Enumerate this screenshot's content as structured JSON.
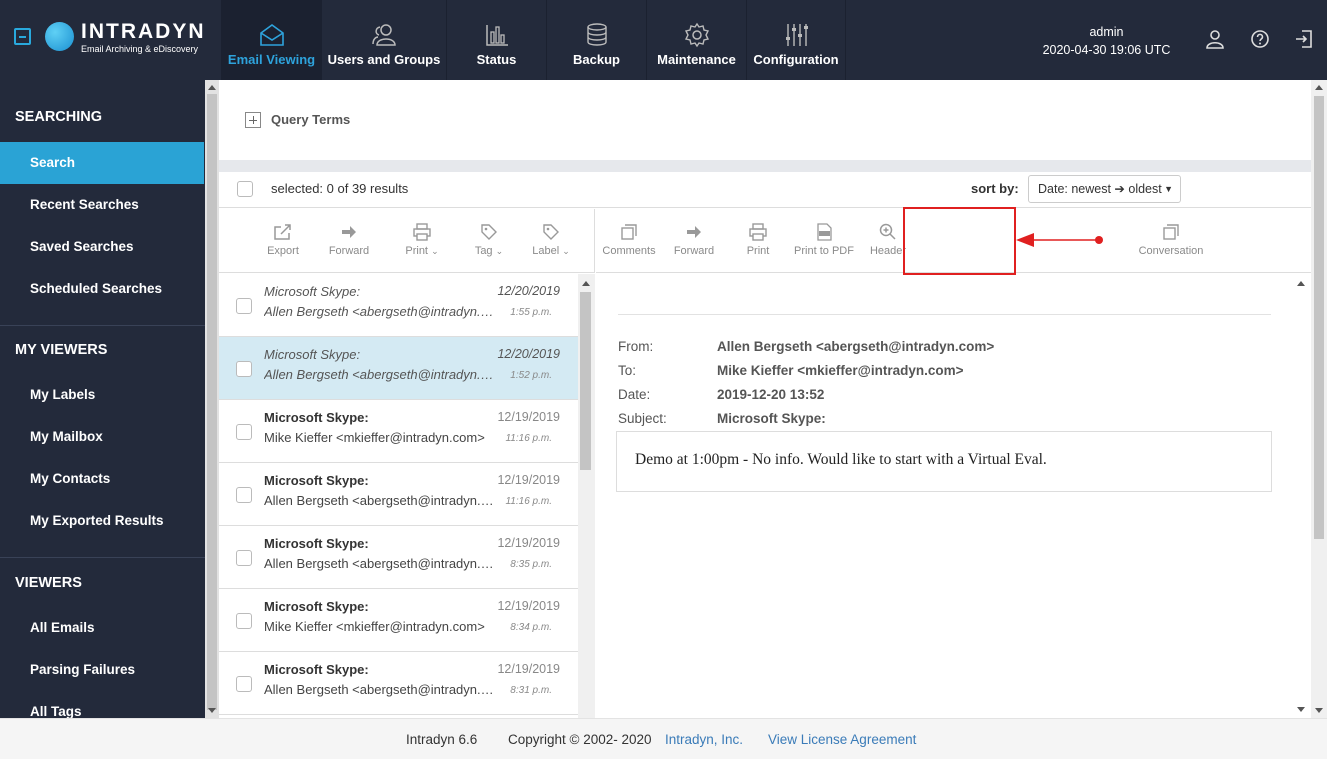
{
  "brand": {
    "name": "INTRADYN",
    "tagline": "Email Archiving & eDiscovery"
  },
  "nav": [
    {
      "label": "Email Viewing",
      "icon": "envelope-icon",
      "active": true
    },
    {
      "label": "Users and Groups",
      "icon": "users-icon"
    },
    {
      "label": "Status",
      "icon": "bar-chart-icon"
    },
    {
      "label": "Backup",
      "icon": "database-icon"
    },
    {
      "label": "Maintenance",
      "icon": "gear-icon"
    },
    {
      "label": "Configuration",
      "icon": "sliders-icon"
    }
  ],
  "user": {
    "name": "admin",
    "datetime": "2020-04-30 19:06 UTC"
  },
  "sidebar": {
    "sections": [
      {
        "title": "SEARCHING",
        "items": [
          "Search",
          "Recent Searches",
          "Saved Searches",
          "Scheduled Searches"
        ]
      },
      {
        "title": "MY VIEWERS",
        "items": [
          "My Labels",
          "My Mailbox",
          "My Contacts",
          "My Exported Results"
        ]
      },
      {
        "title": "VIEWERS",
        "items": [
          "All Emails",
          "Parsing Failures",
          "All Tags"
        ]
      }
    ],
    "active_item": "Search"
  },
  "query": {
    "label": "Query Terms"
  },
  "results": {
    "selected_text": "selected: 0 of 39 results",
    "sort_label": "sort by:",
    "sort_value": "Date: newest ➔ oldest"
  },
  "toolbar_left": [
    {
      "label": "Export",
      "icon": "export-icon"
    },
    {
      "label": "Forward",
      "icon": "forward-arrow-icon"
    },
    {
      "label": "Print",
      "icon": "printer-icon",
      "dropdown": true
    },
    {
      "label": "Tag",
      "icon": "tag-icon",
      "dropdown": true
    },
    {
      "label": "Label",
      "icon": "label-icon",
      "dropdown": true
    }
  ],
  "toolbar_right": [
    {
      "label": "Comments",
      "icon": "comments-icon"
    },
    {
      "label": "Forward",
      "icon": "forward-arrow-icon"
    },
    {
      "label": "Print",
      "icon": "printer-icon"
    },
    {
      "label": "Print to PDF",
      "icon": "pdf-icon"
    },
    {
      "label": "Header",
      "icon": "zoom-in-icon"
    },
    {
      "label": "Conversation",
      "icon": "conversation-icon"
    }
  ],
  "emails": [
    {
      "subject": "Microsoft Skype:",
      "from": "Allen Bergseth <abergseth@intradyn.com>",
      "date": "12/20/2019",
      "time": "1:55 p.m.",
      "read": true
    },
    {
      "subject": "Microsoft Skype:",
      "from": "Allen Bergseth <abergseth@intradyn.com>",
      "date": "12/20/2019",
      "time": "1:52 p.m.",
      "read": true,
      "selected": true
    },
    {
      "subject": "Microsoft Skype:",
      "from": "Mike Kieffer <mkieffer@intradyn.com>",
      "date": "12/19/2019",
      "time": "11:16 p.m."
    },
    {
      "subject": "Microsoft Skype:",
      "from": "Allen Bergseth <abergseth@intradyn.com>",
      "date": "12/19/2019",
      "time": "11:16 p.m."
    },
    {
      "subject": "Microsoft Skype:",
      "from": "Allen Bergseth <abergseth@intradyn.com>",
      "date": "12/19/2019",
      "time": "8:35 p.m."
    },
    {
      "subject": "Microsoft Skype:",
      "from": "Mike Kieffer <mkieffer@intradyn.com>",
      "date": "12/19/2019",
      "time": "8:34 p.m."
    },
    {
      "subject": "Microsoft Skype:",
      "from": "Allen Bergseth <abergseth@intradyn.com>",
      "date": "12/19/2019",
      "time": "8:31 p.m."
    }
  ],
  "preview": {
    "from_label": "From:",
    "from": "Allen Bergseth <abergseth@intradyn.com>",
    "to_label": "To:",
    "to": "Mike Kieffer <mkieffer@intradyn.com>",
    "date_label": "Date:",
    "date": "2019-12-20 13:52",
    "subject_label": "Subject:",
    "subject": "Microsoft Skype:",
    "body": "Demo at 1:00pm - No info.  Would like to start with a Virtual Eval."
  },
  "footer": {
    "version": "Intradyn 6.6",
    "copyright": "Copyright © 2002- 2020",
    "company": "Intradyn, Inc.",
    "license": "View License Agreement"
  },
  "colors": {
    "topbar": "#232a3b",
    "accent": "#2aa3d5",
    "selected_row": "#d4eaf3",
    "highlight": "#e02020"
  }
}
